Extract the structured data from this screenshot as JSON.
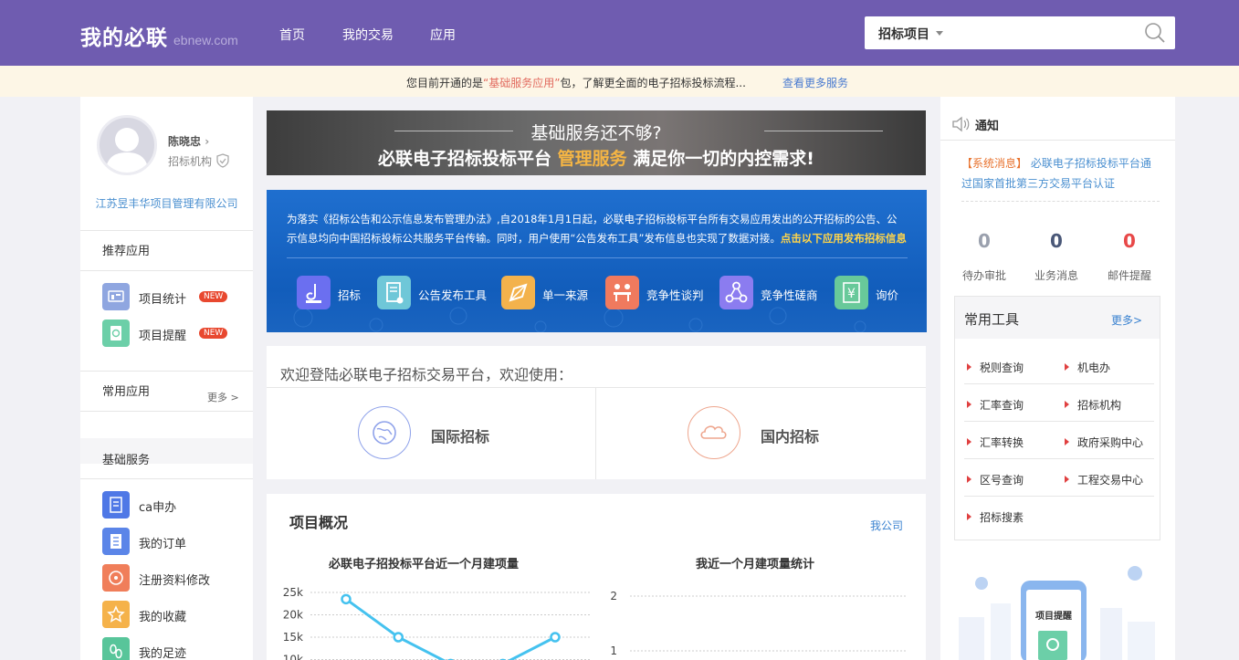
{
  "header": {
    "logo": "我的必联",
    "logo_sub": "ebnew.com",
    "nav": [
      "首页",
      "我的交易",
      "应用"
    ],
    "search": {
      "selected": "招标项目",
      "value": ""
    }
  },
  "notice_bar": {
    "prefix": "您目前开通的是",
    "highlight": "“基础服务应用”",
    "suffix": "包，了解更全面的电子招标投标流程...",
    "link": "查看更多服务"
  },
  "user": {
    "name": "陈晓忠",
    "role": "招标机构",
    "company": "江苏昱丰华项目管理有限公司"
  },
  "sidebar": {
    "recommended_title": "推荐应用",
    "recommended": [
      {
        "label": "项目统计",
        "badge": "NEW",
        "color": "#8fa6e0"
      },
      {
        "label": "项目提醒",
        "badge": "NEW",
        "color": "#6ccfa8"
      }
    ],
    "common_title": "常用应用",
    "common_more": "更多 >",
    "basic_title": "基础服务",
    "basic": [
      {
        "label": "ca申办",
        "color": "#4f78e6"
      },
      {
        "label": "我的订单",
        "color": "#5b85e8"
      },
      {
        "label": "注册资料修改",
        "color": "#f07e5a"
      },
      {
        "label": "我的收藏",
        "color": "#f5b24a"
      },
      {
        "label": "我的足迹",
        "color": "#58c59a"
      }
    ]
  },
  "banner1": {
    "top": "基础服务还不够?",
    "bottom_prefix": "必联电子招标投标平台 ",
    "bottom_highlight": "管理服务",
    "bottom_suffix": " 满足你一切的内控需求!"
  },
  "banner2": {
    "text_prefix": "为落实《招标公告和公示信息发布管理办法》,自2018年1月1日起，必联电子招标投标平台所有交易应用发出的公开招标的公告、公示信息均向中国招标投标公共服务平台传输。同时，用户使用“公告发布工具”发布信息也实现了数据对接。",
    "text_highlight": "点击以下应用发布招标信息",
    "services": [
      {
        "label": "招标",
        "color": "#6b6ff0"
      },
      {
        "label": "公告发布工具",
        "color": "#6fc7d8"
      },
      {
        "label": "单一来源",
        "color": "#f3b24c"
      },
      {
        "label": "竞争性谈判",
        "color": "#f07a5e"
      },
      {
        "label": "竞争性磋商",
        "color": "#8b7cf0"
      },
      {
        "label": "询价",
        "color": "#68c99a"
      }
    ]
  },
  "welcome": {
    "title": "欢迎登陆必联电子招标交易平台，欢迎使用：",
    "intl": "国际招标",
    "domestic": "国内招标"
  },
  "overview": {
    "title": "项目概况",
    "link": "我公司"
  },
  "chart_data": [
    {
      "type": "line",
      "title": "必联电子招投标平台近一个月建项量",
      "y_ticks": [
        "25k",
        "20k",
        "15k",
        "10k"
      ],
      "ylim": [
        0,
        25000
      ],
      "x": [
        1,
        2,
        3,
        4,
        5
      ],
      "values": [
        23500,
        15000,
        9000,
        9000,
        15000
      ],
      "color": "#45c2ef"
    },
    {
      "type": "line",
      "title": "我近一个月建项量统计",
      "y_ticks": [
        "2",
        "1"
      ],
      "ylim": [
        0,
        2
      ],
      "x": [],
      "values": []
    }
  ],
  "rightcol": {
    "notice_title": "通知",
    "message_tag": "【系统消息】",
    "message": "必联电子招标投标平台通过国家首批第三方交易平台认证",
    "stats": [
      {
        "value": "0",
        "label": "待办审批",
        "color": "#9aa0ad"
      },
      {
        "value": "0",
        "label": "业务消息",
        "color": "#4a5878"
      },
      {
        "value": "0",
        "label": "邮件提醒",
        "color": "#e84848"
      }
    ],
    "tools_title": "常用工具",
    "tools_more": "更多>",
    "tools": [
      "税则查询",
      "机电办",
      "汇率查询",
      "招标机构",
      "汇率转换",
      "政府采购中心",
      "区号查询",
      "工程交易中心",
      "招标搜素"
    ],
    "phone_label": "项目提醒"
  }
}
